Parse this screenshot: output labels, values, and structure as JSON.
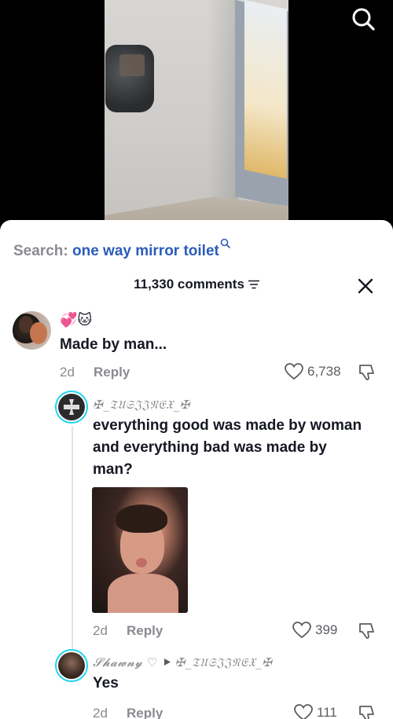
{
  "video": {
    "search_icon": "search-icon"
  },
  "search": {
    "label": "Search:",
    "query": "one way mirror toilet"
  },
  "comments": {
    "count_label": "11,330 comments",
    "sort_icon": "sort-icon",
    "close_icon": "close-icon",
    "items": [
      {
        "emojis": "💞🐱",
        "text": "Made by man...",
        "age": "2d",
        "reply_label": "Reply",
        "likes": "6,738"
      }
    ],
    "replies": [
      {
        "username": "✠_𝔗𝔘𝔖𝔍𝔍𝔑𝔈𝔛_✠",
        "text_lines": [
          "everything good was made by woman",
          "and everything bad was made by",
          "man?"
        ],
        "age": "2d",
        "reply_label": "Reply",
        "likes": "399"
      },
      {
        "username": "𝓢𝓱𝓪𝔀𝓷𝔂 ♡",
        "reply_to": "✠_𝔗𝔘𝔖𝔍𝔍𝔑𝔈𝔛_✠",
        "text": "Yes",
        "age": "2d",
        "reply_label": "Reply",
        "likes": "111"
      }
    ]
  },
  "colors": {
    "accent_link": "#2b5db8",
    "ring": "#20d5ec",
    "muted": "#8a8b91",
    "text": "#161823"
  }
}
